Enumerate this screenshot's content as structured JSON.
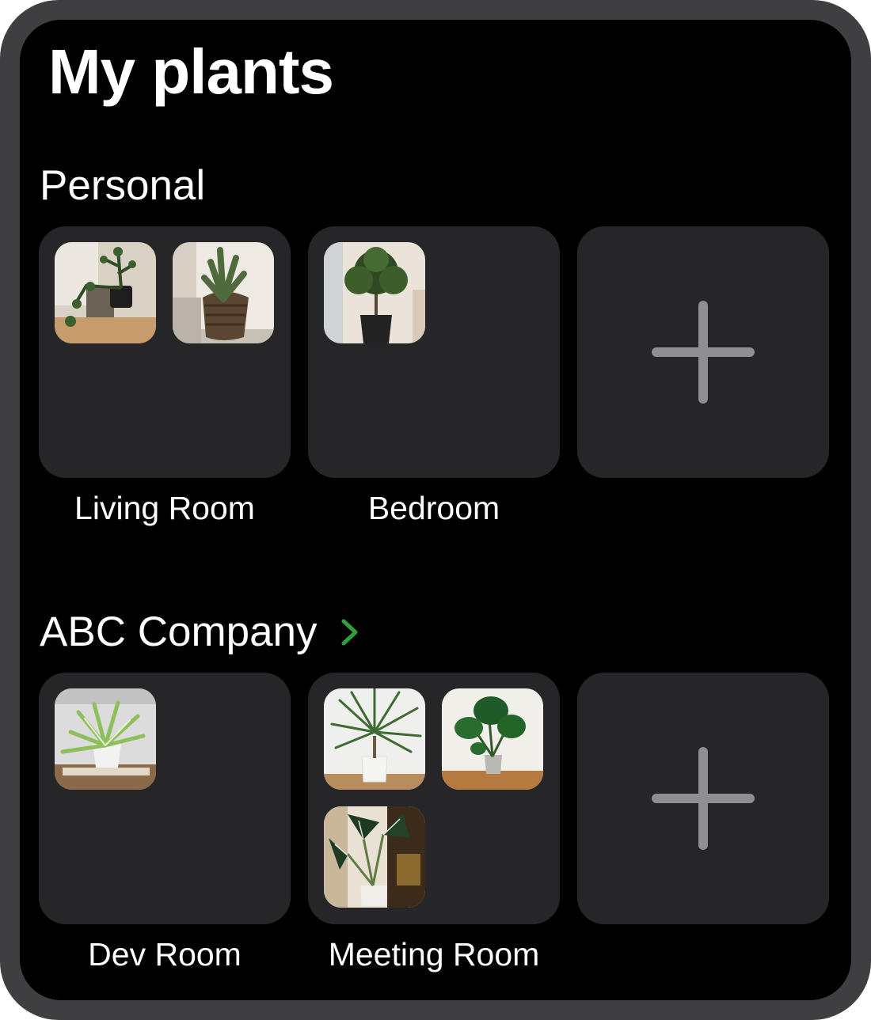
{
  "page": {
    "title": "My plants"
  },
  "sections": [
    {
      "title": "Personal",
      "has_chevron": false,
      "rooms": [
        {
          "name": "Living Room",
          "photos": [
            "zz-plant-photo",
            "cactus-basket-photo"
          ]
        },
        {
          "name": "Bedroom",
          "photos": [
            "potted-tree-photo"
          ]
        }
      ]
    },
    {
      "title": "ABC Company",
      "has_chevron": true,
      "rooms": [
        {
          "name": "Dev Room",
          "photos": [
            "spider-plant-photo"
          ]
        },
        {
          "name": "Meeting Room",
          "photos": [
            "dracaena-photo",
            "monstera-photo",
            "alocasia-photo"
          ]
        }
      ]
    }
  ],
  "icons": {
    "add": "plus-icon",
    "chevron": "chevron-right-icon"
  },
  "colors": {
    "background": "#000000",
    "tile": "#262628",
    "accent_chevron": "#2f9e3e",
    "add_icon": "#8e8e93",
    "frame": "#3f3f41"
  }
}
